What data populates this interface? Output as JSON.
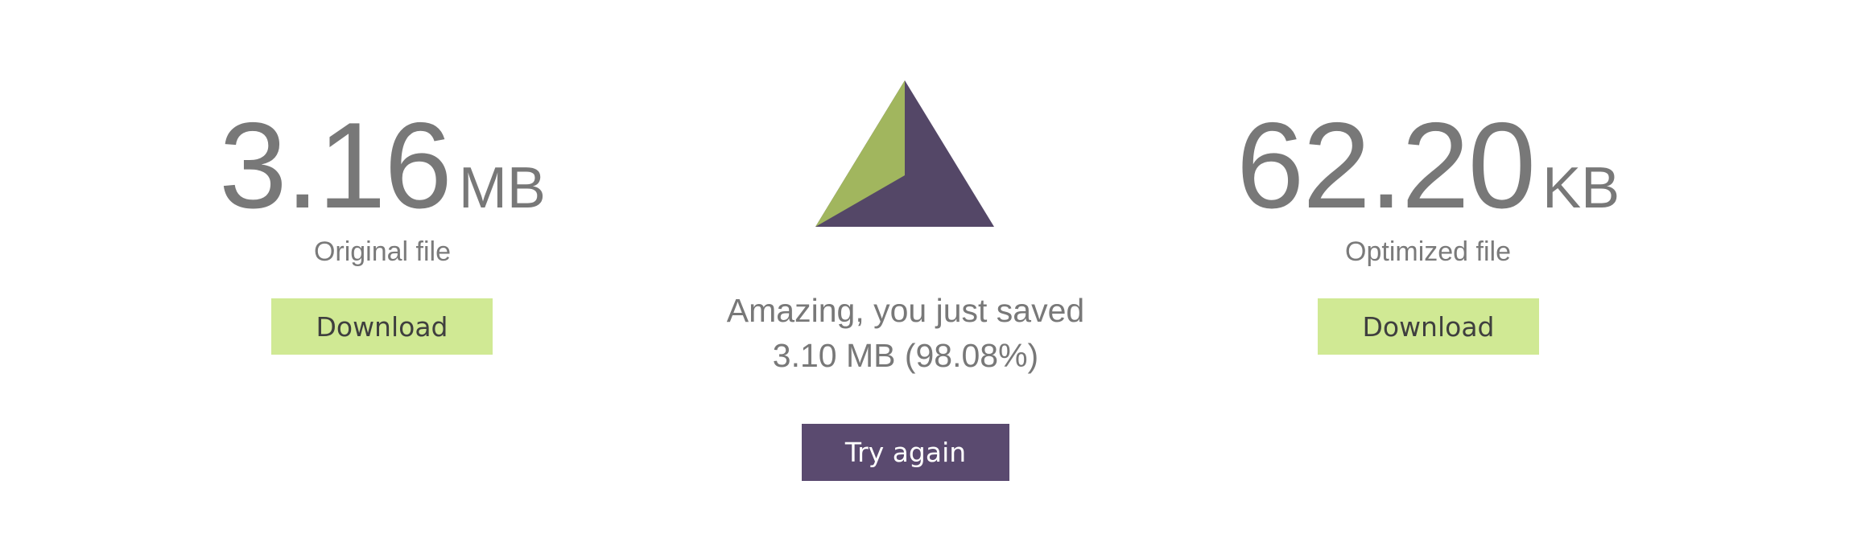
{
  "original": {
    "size_number": "3.16",
    "size_unit": "MB",
    "caption": "Original file",
    "download_label": "Download"
  },
  "optimized": {
    "size_number": "62.20",
    "size_unit": "KB",
    "caption": "Optimized file",
    "download_label": "Download"
  },
  "result": {
    "headline": "Amazing, you just saved",
    "savings": "3.10 MB (98.08%)",
    "retry_label": "Try again"
  },
  "colors": {
    "download_bg": "#d0e994",
    "retry_bg": "#5a4a6f",
    "logo_green": "#a1b65e",
    "logo_purple": "#544767"
  },
  "logo_icon": "triangle-logo-icon"
}
